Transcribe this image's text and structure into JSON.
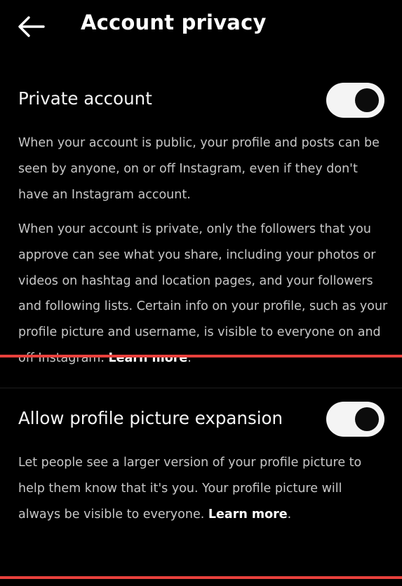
{
  "header": {
    "back_icon": "arrow-left-icon",
    "title": "Account privacy"
  },
  "private_account": {
    "title": "Private account",
    "toggle_on": true,
    "para1": "When your account is public, your profile and posts can be seen by anyone, on or off Instagram, even if they don't have an Instagram account.",
    "para2": "When your account is private, only the followers that you approve can see what you share, including your photos or videos on hashtag and location pages, and your followers and following lists. Certain info on your profile, such as your profile picture and username, is visible to everyone on and off Instagram.",
    "learn_more": "Learn more",
    "end_punct": "."
  },
  "profile_expansion": {
    "title": "Allow profile picture expansion",
    "toggle_on": true,
    "para": "Let people see a larger version of your profile picture to help them know that it's you. Your profile picture will always be visible to everyone.",
    "learn_more": "Learn more",
    "end_punct": "."
  },
  "colors": {
    "background": "#000000",
    "annotation_line": "#e8403c",
    "toggle_track": "#f4f4f4",
    "toggle_knob": "#0c0c0c"
  }
}
